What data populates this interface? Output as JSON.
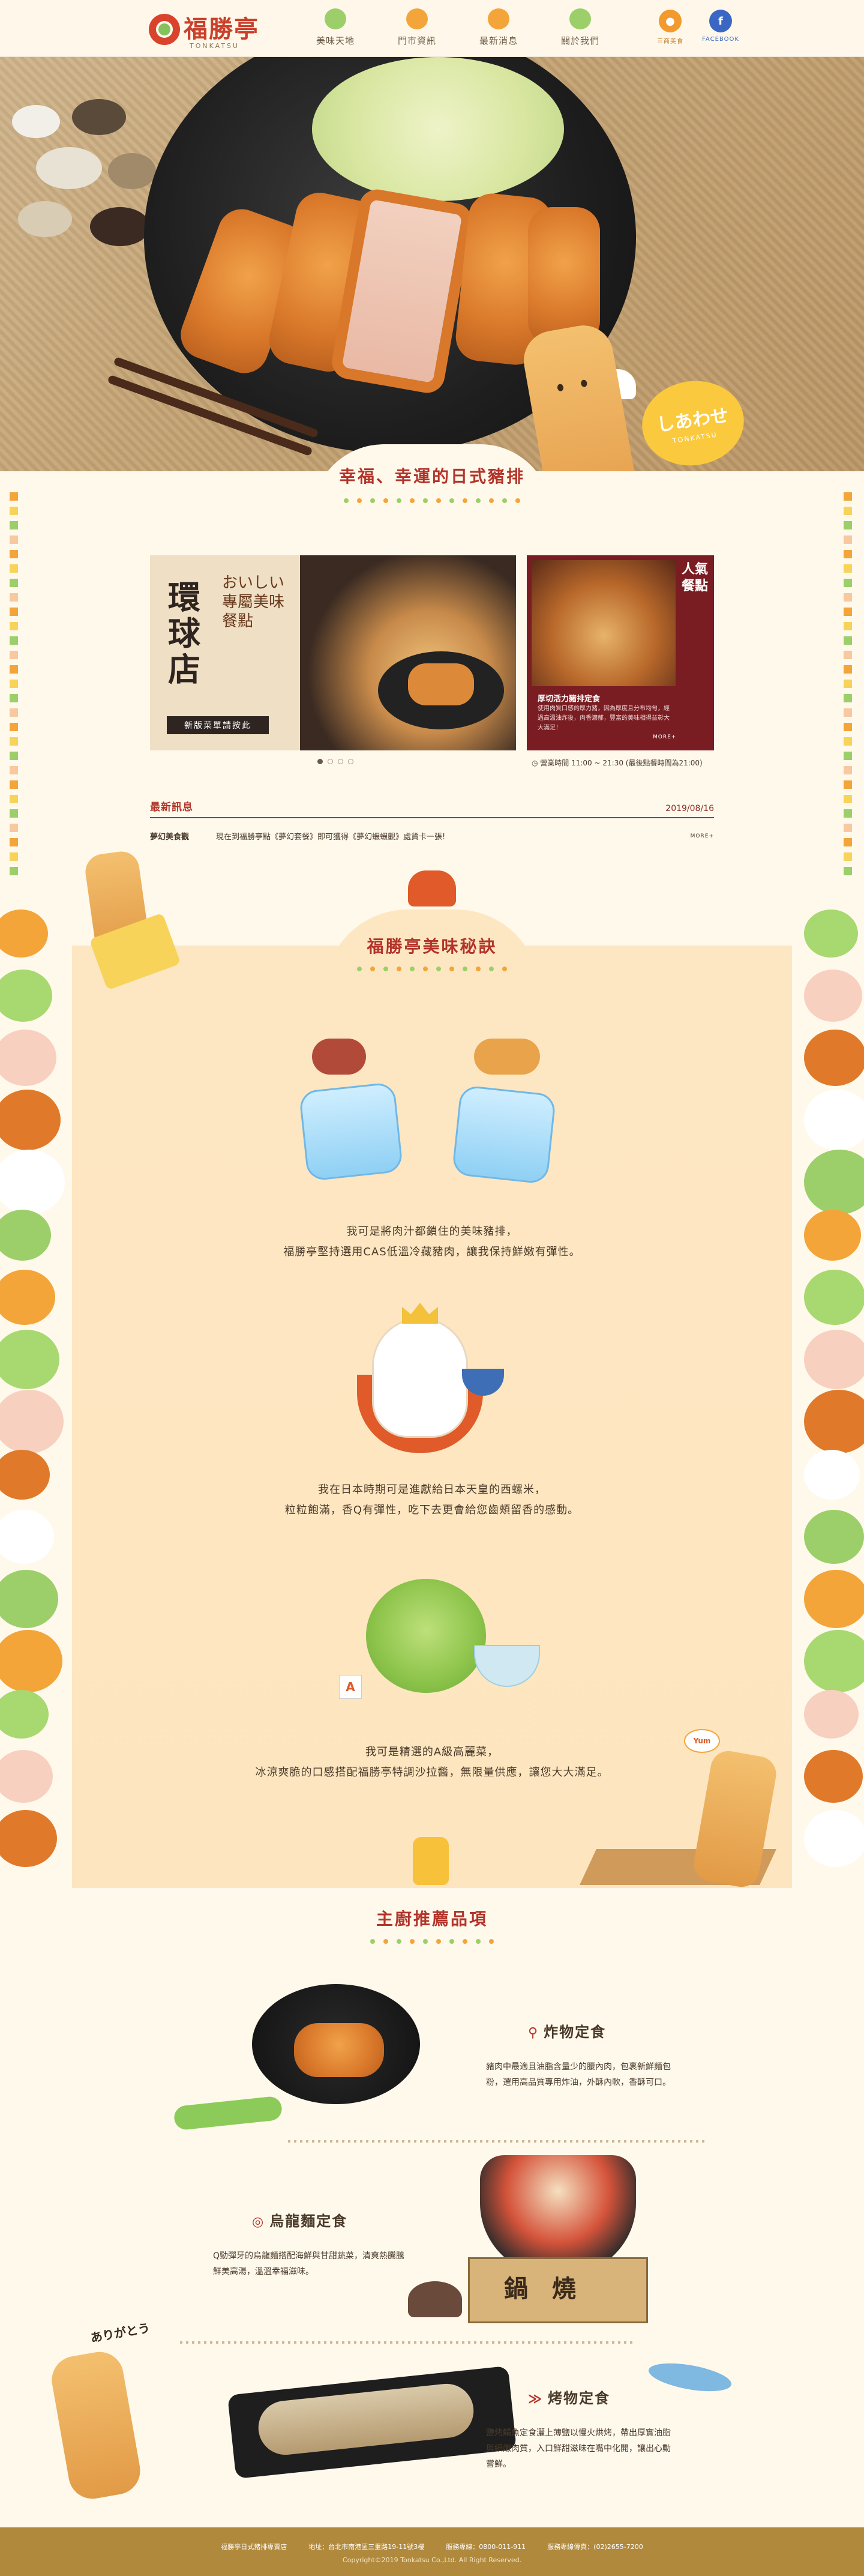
{
  "header": {
    "logo_text": "福勝亭",
    "logo_sub": "TONKATSU",
    "nav": [
      {
        "label": "美味天地",
        "icon": "leaf-icon"
      },
      {
        "label": "門市資訊",
        "icon": "store-icon"
      },
      {
        "label": "最新消息",
        "icon": "megaphone-icon"
      },
      {
        "label": "關於我們",
        "icon": "leaf-icon"
      }
    ],
    "social": [
      {
        "label": "三商美食",
        "icon": "orange-circle-icon"
      },
      {
        "label": "FACEBOOK",
        "icon": "facebook-icon",
        "glyph": "f"
      }
    ]
  },
  "hero": {
    "speech_main": "しあわせ",
    "speech_sub": "TONKATSU"
  },
  "intro": {
    "title": "幸福、幸運的日式豬排"
  },
  "banner_main": {
    "store": "環球店",
    "poem": "おいしい專屬美味餐點",
    "button": "新版菜單請按此"
  },
  "banner_side": {
    "tag": "人氣餐點",
    "title": "厚切活力豬排定食",
    "desc": "使用肉質口感的厚力豬，因為厚度且分布均勻，經過高溫油炸後，肉香濃郁，豐富的美味相得益彰大大滿足！",
    "more": "MORE+"
  },
  "hours": "營業時間 11:00 ~ 21:30 (最後點餐時間為21:00)",
  "news": {
    "title": "最新訊息",
    "date": "2019/08/16",
    "category": "夢幻美食觀",
    "text": "現在到福勝亭點《夢幻套餐》即可獲得《夢幻蝦蝦觀》處貨卡一張!",
    "more": "MORE+"
  },
  "secrets": {
    "title": "福勝亭美味秘訣",
    "items": [
      {
        "line1": "我可是將肉汁都鎖住的美味豬排，",
        "line2": "福勝亭堅持選用CAS低溫冷藏豬肉，讓我保持鮮嫩有彈性。"
      },
      {
        "line1": "我在日本時期可是進獻給日本天皇的西螺米，",
        "line2": "粒粒飽滿，香Q有彈性，吃下去更會給您齒頰留香的感動。"
      },
      {
        "line1": "我可是精選的A級高麗菜，",
        "line2": "冰涼爽脆的口感搭配福勝亭特調沙拉醬，無限量供應，讓您大大滿足。"
      }
    ],
    "card_letter": "A",
    "sign": "Yum"
  },
  "recommend": {
    "title": "主廚推薦品項",
    "items": [
      {
        "name": "炸物定食",
        "desc": "豬肉中最適且油脂含量少的腰內肉，包裹新鮮麵包粉，選用高品質專用炸油，外酥內軟，香酥可口。"
      },
      {
        "name": "烏龍麵定食",
        "desc": "Q勁彈牙的烏龍麵搭配海鮮與甘甜蔬菜，清爽熱騰騰鮮美高湯，溫溫幸福滋味。"
      },
      {
        "name": "烤物定食",
        "desc": "鹽烤鯖魚定食灑上薄鹽以慢火烘烤，帶出厚實油脂與細嫩肉質，入口鮮甜滋味在嘴中化開，讓出心動嘗鮮。"
      }
    ],
    "pot_text": "鍋燒",
    "arigatou": "ありがとう"
  },
  "footer": {
    "company": "福勝亭日式豬排專賣店",
    "address": "地址：台北市南港區三重路19-11號3樓",
    "phone": "服務專線：0800-011-911",
    "fax": "服務專線傳真：(02)2655-7200",
    "copyright": "Copyright©2019 Tonkatsu Co.,Ltd. All Right Reserved."
  },
  "colors": {
    "accent_red": "#b2342a",
    "accent_green": "#9ccf6a",
    "accent_orange": "#f3a53a",
    "footer_bg": "#b0893d"
  }
}
